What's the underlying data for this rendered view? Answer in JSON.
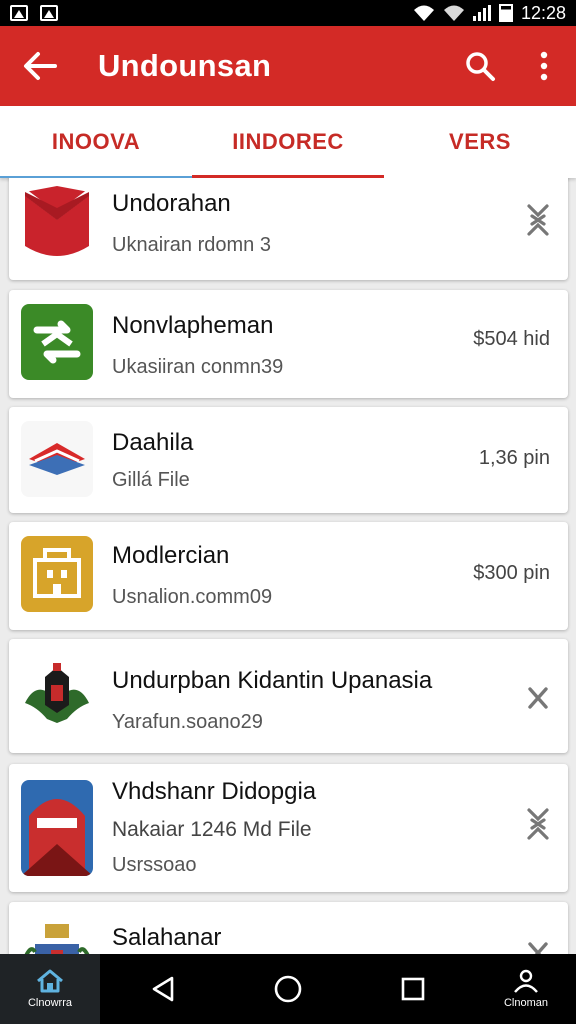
{
  "status_bar": {
    "time": "12:28",
    "battery_icon": "battery-icon",
    "wifi_icon": "wifi-icon"
  },
  "app_bar": {
    "title": "Undounsan",
    "back_icon": "arrow-back-icon",
    "search_icon": "search-icon",
    "menu_icon": "more-vert-icon",
    "color": "#d32a26"
  },
  "tabs": [
    {
      "label": "INOOVA",
      "active": false
    },
    {
      "label": "IINDOREC",
      "active": true
    },
    {
      "label": "VERS",
      "active": false
    }
  ],
  "items": [
    {
      "title": "Undorahan",
      "subtitle": "Uknairan rdomn 3",
      "trailing": "",
      "trailing_icon": "expand-icon"
    },
    {
      "title": "Nonvlapheman",
      "subtitle": "Ukasiiran conmn39",
      "trailing": "$504 hid",
      "trailing_icon": ""
    },
    {
      "title": "Daahila",
      "subtitle": "Gillá File",
      "trailing": "1,36 pin",
      "trailing_icon": ""
    },
    {
      "title": "Modlercian",
      "subtitle": "Usnalion.comm09",
      "trailing": "$300 pin",
      "trailing_icon": ""
    },
    {
      "title": "Undurpban Kidantin Upanasia",
      "subtitle": "Yarafun.soano29",
      "trailing": "",
      "trailing_icon": "close-icon"
    },
    {
      "title": "Vhdshanr Didopgia",
      "subtitle": "Nakaiar 1246 Md File",
      "subtitle2": "Usrssoao",
      "trailing": "",
      "trailing_icon": "expand-icon"
    },
    {
      "title": "Salahanar",
      "subtitle": "",
      "trailing": "",
      "trailing_icon": "close-icon"
    }
  ],
  "nav": {
    "home_label": "Clnowrra",
    "profile_label": "Clnoman"
  }
}
